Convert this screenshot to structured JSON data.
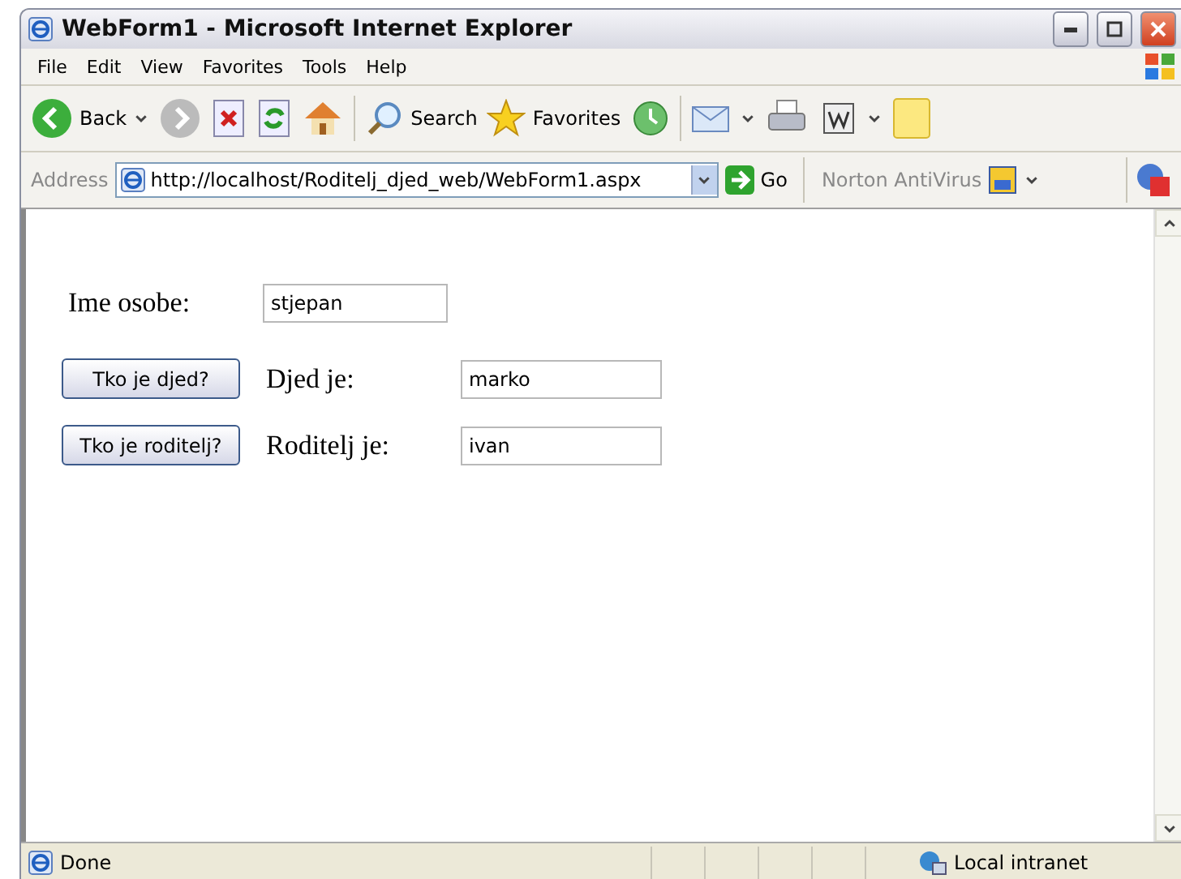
{
  "window": {
    "title": "WebForm1 - Microsoft Internet Explorer"
  },
  "menu": [
    "File",
    "Edit",
    "View",
    "Favorites",
    "Tools",
    "Help"
  ],
  "toolbar": {
    "back": "Back",
    "search": "Search",
    "favorites": "Favorites"
  },
  "address_bar": {
    "label": "Address",
    "url": "http://localhost/Roditelj_djed_web/WebForm1.aspx",
    "go": "Go",
    "norton": "Norton AntiVirus"
  },
  "form": {
    "name_label": "Ime osobe:",
    "name_value": "stjepan",
    "rows": [
      {
        "button": "Tko je djed?",
        "label": "Djed je:",
        "value": "marko"
      },
      {
        "button": "Tko je roditelj?",
        "label": "Roditelj je:",
        "value": "ivan"
      }
    ]
  },
  "status_bar": {
    "status": "Done",
    "zone": "Local intranet"
  }
}
